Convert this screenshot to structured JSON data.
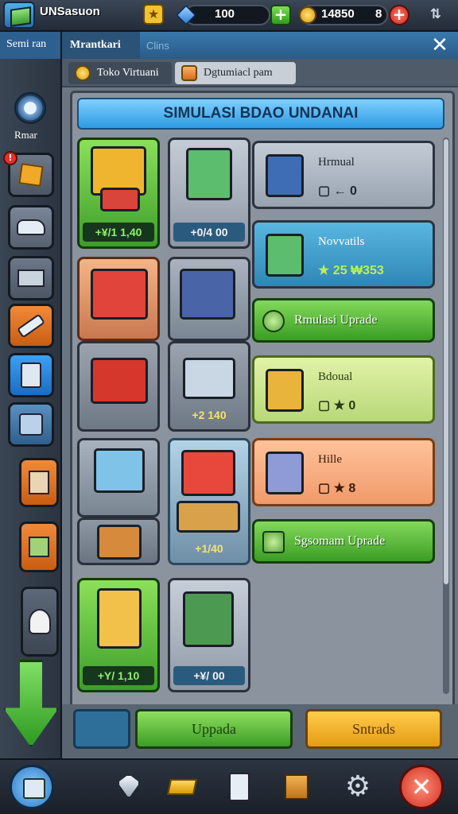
{
  "topbar": {
    "game_title": "UNSasuon",
    "game_subtitle": "",
    "gems": "100",
    "coins": "14850",
    "coin_suffix": "8"
  },
  "header": {
    "side_label": "Semi ran",
    "active_tab": "Mrantkari",
    "inactive_tab": "Clins",
    "close_label": "✕"
  },
  "filters": [
    {
      "label": "Toko Virtuani",
      "icon": "coin-icon"
    },
    {
      "label": "Dgtumiacl pam",
      "icon": "orange-card-icon"
    }
  ],
  "sidebar": {
    "label": "Rmar",
    "alert_count": "!"
  },
  "main": {
    "title": "SIMULASI BDAO UNDANAI",
    "cards": [
      {
        "name": "market-stall",
        "price": "+¥/1 1,40"
      },
      {
        "name": "vending-cart",
        "price": "+0/4 00"
      },
      {
        "name": "kiosk-red-awning",
        "price": ""
      },
      {
        "name": "shop-blue-roof",
        "price": ""
      },
      {
        "name": "gift-box-red",
        "price": ""
      },
      {
        "name": "cash-register",
        "price": "+2 140"
      },
      {
        "name": "fridge-display",
        "price": ""
      },
      {
        "name": "cart-striped",
        "price": ""
      },
      {
        "name": "food-cart",
        "price": "+1/40"
      },
      {
        "name": "chest-stall",
        "price": ""
      },
      {
        "name": "tall-shop",
        "price": "+Y/ 1,10"
      },
      {
        "name": "book-stand",
        "price": "+¥/ 00"
      }
    ],
    "info_panels": [
      {
        "name": "Hrmual",
        "stat": "▢ ← 0",
        "theme": "gray"
      },
      {
        "name": "Novvatils",
        "stat": "★ 25   ₩353",
        "theme": "teal"
      },
      {
        "name": "Bdoual",
        "stat": "▢ ★ 0",
        "theme": "lime"
      },
      {
        "name": "Hille",
        "stat": "▢ ★ 8",
        "theme": "peach"
      }
    ],
    "upgrade_buttons": [
      {
        "label": "Rmulasi Uprade"
      },
      {
        "label": "Sgsomam Uprade"
      }
    ],
    "buttons": {
      "upgrade": "Uppada",
      "trade": "Sntrads"
    }
  },
  "colors": {
    "accent_blue": "#2e9be2",
    "accent_green": "#3b9d24",
    "accent_orange": "#e59b12"
  }
}
